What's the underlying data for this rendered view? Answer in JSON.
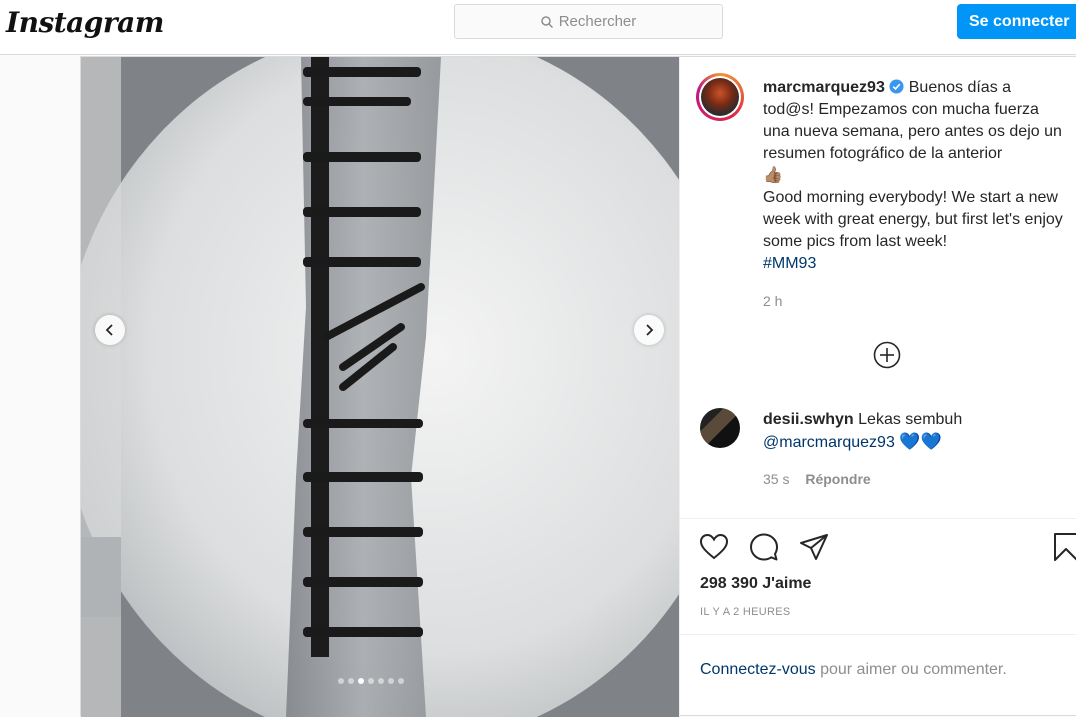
{
  "header": {
    "logo": "Instagram",
    "search_placeholder": "Rechercher",
    "login_label": "Se connecter"
  },
  "carousel": {
    "dot_count": 7,
    "active_index": 2
  },
  "post": {
    "username": "marcmarquez93",
    "caption_es": "Buenos días a tod@s! Empezamos con mucha fuerza una nueva semana, pero antes os dejo un resumen fotográfico de la anterior",
    "caption_emoji": "👍🏽",
    "caption_en": "Good morning everybody! We start a new week with great energy, but first let's enjoy some pics from last week!",
    "hashtag": "#MM93",
    "time": "2 h"
  },
  "comment": {
    "username": "desii.swhyn",
    "text": "Lekas sembuh",
    "mention": "@marcmarquez93",
    "hearts": "💙💙",
    "time": "35 s",
    "reply_label": "Répondre"
  },
  "stats": {
    "likes": "298 390 J'aime",
    "posted_ago": "IL Y A 2 HEURES"
  },
  "login_prompt": {
    "link": "Connectez-vous",
    "rest": " pour aimer ou commenter."
  },
  "colors": {
    "accent": "#0095f6",
    "link": "#00376b",
    "muted": "#8e8e8e"
  }
}
